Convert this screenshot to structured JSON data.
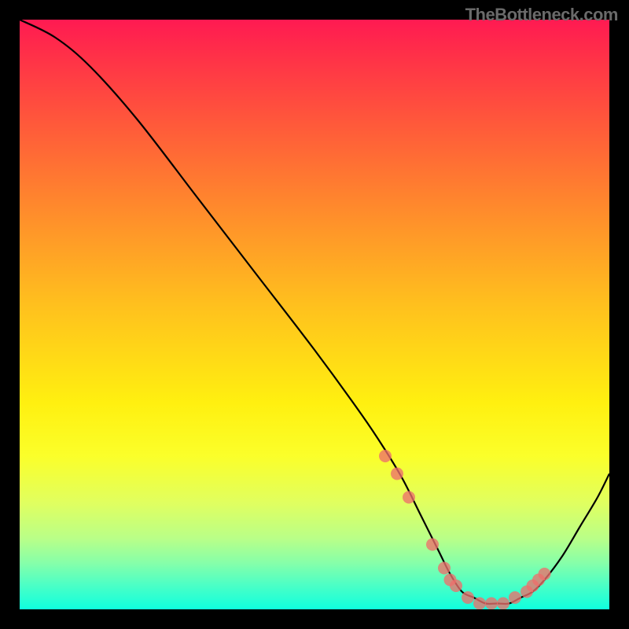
{
  "watermark": "TheBottleneck.com",
  "chart_data": {
    "type": "line",
    "title": "",
    "xlabel": "",
    "ylabel": "",
    "xlim": [
      0,
      100
    ],
    "ylim": [
      0,
      100
    ],
    "background_gradient": {
      "stops": [
        {
          "pct": 0,
          "color": "#ff1a52"
        },
        {
          "pct": 6,
          "color": "#ff3048"
        },
        {
          "pct": 18,
          "color": "#ff5a3a"
        },
        {
          "pct": 32,
          "color": "#ff8a2c"
        },
        {
          "pct": 48,
          "color": "#ffbf1e"
        },
        {
          "pct": 65,
          "color": "#fff010"
        },
        {
          "pct": 74,
          "color": "#fbff2a"
        },
        {
          "pct": 82,
          "color": "#e0ff60"
        },
        {
          "pct": 88,
          "color": "#b9ff88"
        },
        {
          "pct": 92,
          "color": "#88ffa8"
        },
        {
          "pct": 96,
          "color": "#4affc6"
        },
        {
          "pct": 100,
          "color": "#0fffde"
        }
      ]
    },
    "series": [
      {
        "name": "main-curve",
        "x": [
          0,
          6,
          12,
          20,
          30,
          40,
          50,
          58,
          62,
          65,
          68,
          71,
          73,
          75,
          77,
          79,
          81,
          83,
          85,
          87,
          89,
          92,
          95,
          98,
          100
        ],
        "values": [
          100,
          97,
          92,
          83,
          70,
          57,
          44,
          33,
          27,
          22,
          16,
          10,
          6,
          3,
          2,
          1,
          1,
          1,
          2,
          3,
          5,
          9,
          14,
          19,
          23
        ]
      }
    ],
    "markers": {
      "series": "main-curve",
      "points_x": [
        62,
        64,
        66,
        70,
        72,
        73,
        74,
        76,
        78,
        80,
        82,
        84,
        86,
        87,
        88,
        89
      ],
      "points_values": [
        26,
        23,
        19,
        11,
        7,
        5,
        4,
        2,
        1,
        1,
        1,
        2,
        3,
        4,
        5,
        6
      ],
      "color": "#ed6f6c",
      "radius": 8
    }
  }
}
